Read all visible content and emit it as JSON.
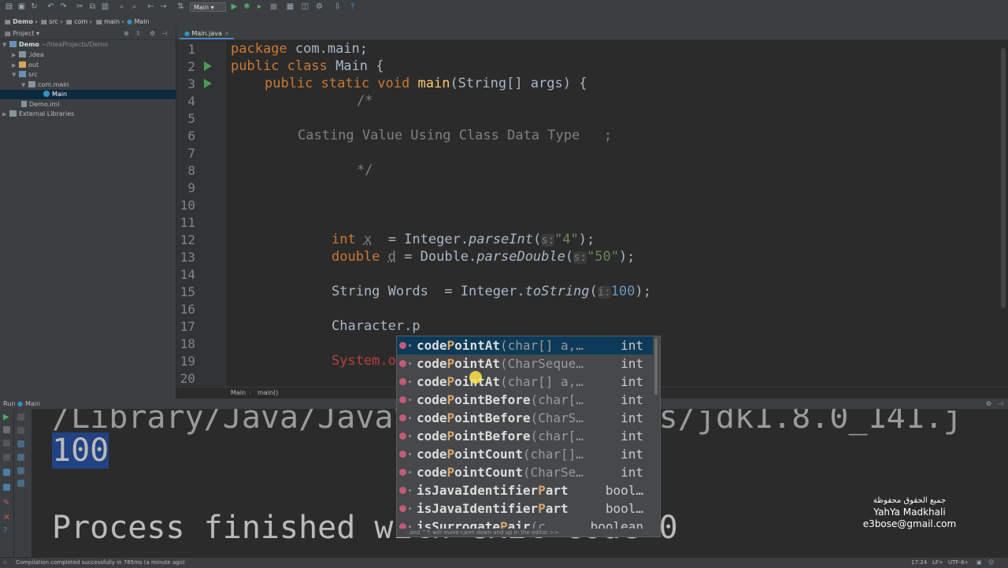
{
  "toolbar": {
    "run_config": "Main",
    "icons": [
      "open-folder",
      "save",
      "sync",
      "undo",
      "redo",
      "cut",
      "copy",
      "paste",
      "find",
      "replace",
      "back",
      "forward",
      "build",
      "run-config",
      "run",
      "debug",
      "run-coverage",
      "stop",
      "project-structure",
      "sdk",
      "settings",
      "help"
    ]
  },
  "breadcrumb": {
    "items": [
      "Demo",
      "src",
      "com",
      "main",
      "Main"
    ]
  },
  "project_panel": {
    "title": "Project",
    "tree": [
      {
        "label": "Demo",
        "sub": "~/IdeaProjects/Demo"
      },
      {
        "label": ".idea"
      },
      {
        "label": "out"
      },
      {
        "label": "src"
      },
      {
        "label": "com.main"
      },
      {
        "label": "Main"
      },
      {
        "label": "Demo.iml"
      },
      {
        "label": "External Libraries"
      }
    ]
  },
  "editor": {
    "tab": "Main.java",
    "line_numbers": [
      "1",
      "2",
      "3",
      "4",
      "5",
      "6",
      "7",
      "8",
      "9",
      "10",
      "11",
      "12",
      "13",
      "14",
      "15",
      "16",
      "17",
      "18",
      "19",
      "20"
    ],
    "l1": {
      "kw": "package",
      "rest": " com.main;"
    },
    "l2": {
      "kw": "public class",
      "rest": " Main {"
    },
    "l3": {
      "kw": "public static void",
      "fn": "main",
      "rest": "(String[] args) {"
    },
    "l4": "/*",
    "l6": "Casting Value Using Class Data Type   ;",
    "l8": "*/",
    "l12": {
      "kw": "int",
      "var": "x",
      "eq": "  = Integer.",
      "method": "parseInt",
      "open": "(",
      "hint": "s:",
      "str": "\"4\"",
      "close": ");"
    },
    "l13": {
      "kw": "double",
      "var": "d",
      "eq": " = Double.",
      "method": "parseDouble",
      "open": "(",
      "hint": "s:",
      "str": "\"50\"",
      "close": ");"
    },
    "l15": {
      "pre": "String Words  = Integer.",
      "method": "toString",
      "open": "(",
      "hint": "i:",
      "num": "100",
      "close": ");"
    },
    "l17": "Character.p",
    "l19": "System.o",
    "crumb_class": "Main",
    "crumb_method": "main()"
  },
  "autocomplete": {
    "items": [
      {
        "pre": "code",
        "match": "P",
        "post": "ointAt",
        "params": "(char[] a,…",
        "type": "int"
      },
      {
        "pre": "code",
        "match": "P",
        "post": "ointAt",
        "params": "(CharSeque…",
        "type": "int"
      },
      {
        "pre": "code",
        "match": "P",
        "post": "ointAt",
        "params": "(char[] a,…",
        "type": "int"
      },
      {
        "pre": "code",
        "match": "P",
        "post": "ointBefore",
        "params": "(char[…",
        "type": "int"
      },
      {
        "pre": "code",
        "match": "P",
        "post": "ointBefore",
        "params": "(CharS…",
        "type": "int"
      },
      {
        "pre": "code",
        "match": "P",
        "post": "ointBefore",
        "params": "(char[…",
        "type": "int"
      },
      {
        "pre": "code",
        "match": "P",
        "post": "ointCount",
        "params": "(char[]…",
        "type": "int"
      },
      {
        "pre": "code",
        "match": "P",
        "post": "ointCount",
        "params": "(CharSe…",
        "type": "int"
      },
      {
        "pre": "isJavaIdentifier",
        "match": "P",
        "post": "art",
        "params": "",
        "type": "bool…"
      },
      {
        "pre": "isJavaIdentifier",
        "match": "P",
        "post": "art",
        "params": "",
        "type": "bool…"
      },
      {
        "pre": "isSurrogate",
        "match": "P",
        "post": "air",
        "params": "(c…",
        "type": "boolean"
      }
    ],
    "footer": "and ^↑ will move caret down and up in the editor  >>"
  },
  "run_panel": {
    "title": "Run",
    "config": "Main",
    "line1": "/Library/Java/JavaVirtualMachines/jdk1.8.0_141.j",
    "output": "100",
    "finished": "Process finished with exit code 0"
  },
  "status_bar": {
    "message": "Compilation completed successfully in 785ms (a minute ago)",
    "position": "17:24",
    "line_sep": "LF÷",
    "encoding": "UTF-8÷"
  },
  "watermark": {
    "line1": "جميع الحقوق محفوظة",
    "line2": "YahYa Madkhali",
    "line3": "e3bose@gmail.com"
  },
  "colors": {
    "keyword": "#cc7832",
    "method": "#ffc66d",
    "string": "#6a8759",
    "number": "#6897bb",
    "comment": "#808080",
    "selection": "#214283"
  }
}
